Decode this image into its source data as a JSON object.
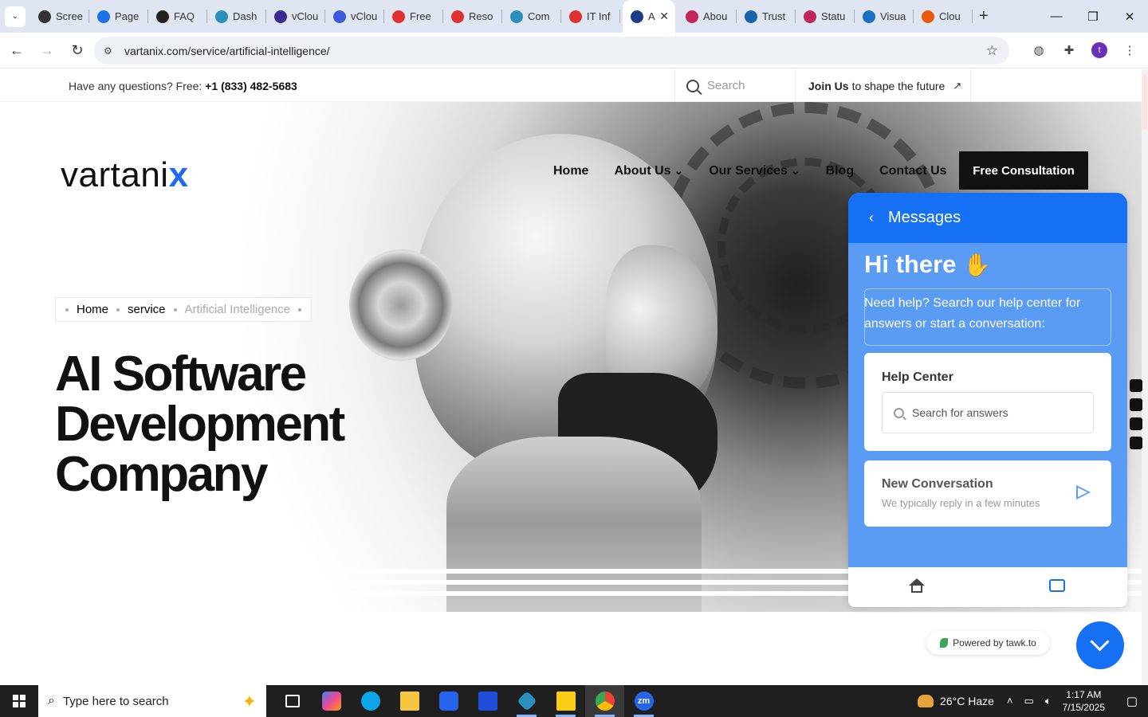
{
  "browser": {
    "tabs": [
      {
        "label": "Scree",
        "icon": "screen-icon",
        "color": "#333333"
      },
      {
        "label": "Page",
        "icon": "page-speed-icon",
        "color": "#1a73e8"
      },
      {
        "label": "FAQ",
        "icon": "faq-icon",
        "color": "#222222"
      },
      {
        "label": "Dash",
        "icon": "dashboard-icon",
        "color": "#2a8fbd"
      },
      {
        "label": "vClou",
        "icon": "vcloud-icon",
        "color": "#3b2b8f"
      },
      {
        "label": "vClou",
        "icon": "vcloud-check-icon",
        "color": "#3b5bdb"
      },
      {
        "label": "Free",
        "icon": "free-icon",
        "color": "#e03131"
      },
      {
        "label": "Reso",
        "icon": "resource-icon",
        "color": "#e03131"
      },
      {
        "label": "Com",
        "icon": "community-icon",
        "color": "#2a8fbd"
      },
      {
        "label": "IT Inf",
        "icon": "it-icon",
        "color": "#e03131"
      },
      {
        "label": "A",
        "icon": "vartanix-icon",
        "color": "#1e3a8a"
      },
      {
        "label": "Abou",
        "icon": "about-icon",
        "color": "#c2255c"
      },
      {
        "label": "Trust",
        "icon": "trust-icon",
        "color": "#1864ab"
      },
      {
        "label": "Statu",
        "icon": "status-icon",
        "color": "#c2255c"
      },
      {
        "label": "Visua",
        "icon": "visual-icon",
        "color": "#1971c2"
      },
      {
        "label": "Clou",
        "icon": "cloud-icon",
        "color": "#e8590c"
      }
    ],
    "active_tab_index": 10,
    "url": "vartanix.com/service/artificial-intelligence/",
    "profile_initial": "t"
  },
  "topbar": {
    "phone_prefix": "Have any questions? Free: ",
    "phone_number": "+1 (833) 482-5683",
    "search_placeholder": "Search",
    "join_bold": "Join Us",
    "join_rest": "to shape the future"
  },
  "header": {
    "logo_main": "vartani",
    "logo_x": "x",
    "nav": [
      "Home",
      "About Us",
      "Our Services",
      "Blog",
      "Contact Us"
    ],
    "cta": "Free Consultation"
  },
  "breadcrumb": {
    "items": [
      "Home",
      "service"
    ],
    "current": "Artificial Intelligence"
  },
  "hero": {
    "title": "AI Software Development Company"
  },
  "chat": {
    "header_title": "Messages",
    "greeting": "Hi there",
    "intro": "Need help? Search our help center for answers or start a conversation:",
    "help_title": "Help Center",
    "help_placeholder": "Search for answers",
    "conv_title": "New Conversation",
    "conv_sub": "We typically reply in a few minutes",
    "powered_by": "Powered by tawk.to",
    "accent": "#1670f3"
  },
  "taskbar": {
    "search_placeholder": "Type here to search",
    "weather": "26°C  Haze",
    "time": "1:17 AM",
    "date": "7/15/2025"
  }
}
